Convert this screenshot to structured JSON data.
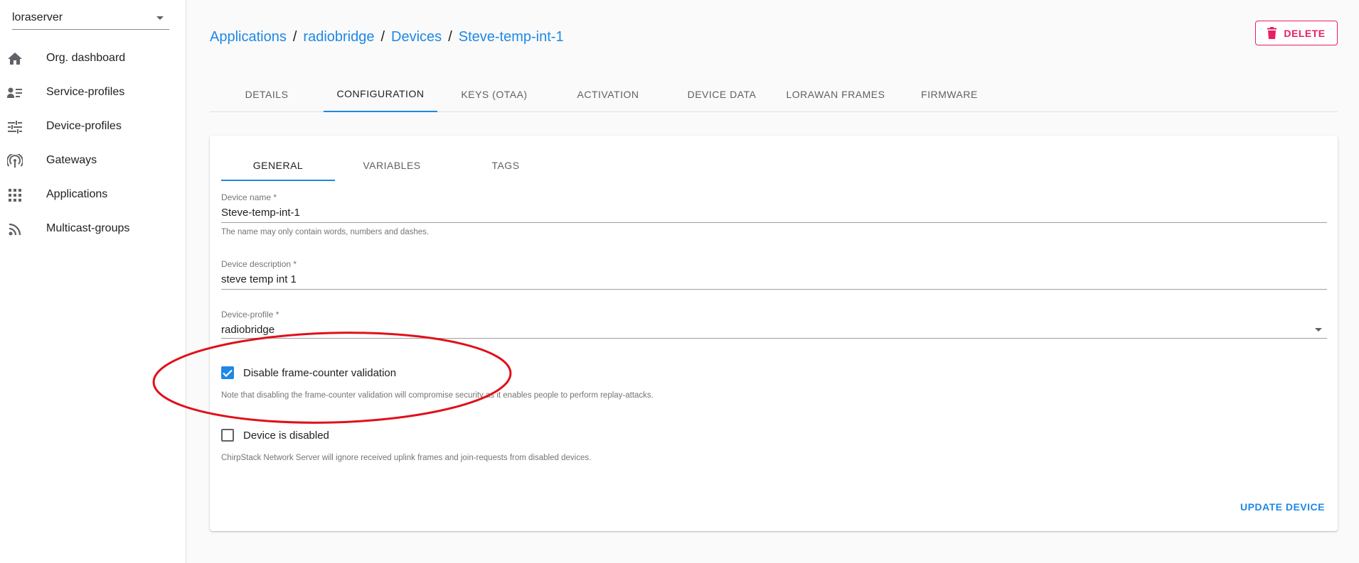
{
  "sidebar": {
    "org_select": "loraserver",
    "items": [
      {
        "label": "Org. dashboard",
        "icon": "home-icon"
      },
      {
        "label": "Service-profiles",
        "icon": "account-details-icon"
      },
      {
        "label": "Device-profiles",
        "icon": "tune-icon"
      },
      {
        "label": "Gateways",
        "icon": "gateway-icon"
      },
      {
        "label": "Applications",
        "icon": "apps-grid-icon"
      },
      {
        "label": "Multicast-groups",
        "icon": "rss-icon"
      }
    ]
  },
  "header": {
    "breadcrumb": [
      "Applications",
      "radiobridge",
      "Devices",
      "Steve-temp-int-1"
    ],
    "separator": "/",
    "delete_label": "DELETE"
  },
  "tabs": [
    "DETAILS",
    "CONFIGURATION",
    "KEYS (OTAA)",
    "ACTIVATION",
    "DEVICE DATA",
    "LORAWAN FRAMES",
    "FIRMWARE"
  ],
  "active_tab": "CONFIGURATION",
  "inner_tabs": [
    "GENERAL",
    "VARIABLES",
    "TAGS"
  ],
  "active_inner_tab": "GENERAL",
  "form": {
    "device_name_label": "Device name *",
    "device_name_value": "Steve-temp-int-1",
    "device_name_help": "The name may only contain words, numbers and dashes.",
    "device_description_label": "Device description *",
    "device_description_value": "steve temp int 1",
    "device_profile_label": "Device-profile *",
    "device_profile_value": "radiobridge",
    "disable_fcnt_label": "Disable frame-counter validation",
    "disable_fcnt_checked": true,
    "disable_fcnt_help": "Note that disabling the frame-counter validation will compromise security as it enables people to perform replay-attacks.",
    "device_disabled_label": "Device is disabled",
    "device_disabled_checked": false,
    "device_disabled_help": "ChirpStack Network Server will ignore received uplink frames and join-requests from disabled devices.",
    "update_label": "UPDATE DEVICE"
  },
  "colors": {
    "accent": "#1e88e5",
    "danger": "#e91e63",
    "annotation": "#e0101a"
  }
}
